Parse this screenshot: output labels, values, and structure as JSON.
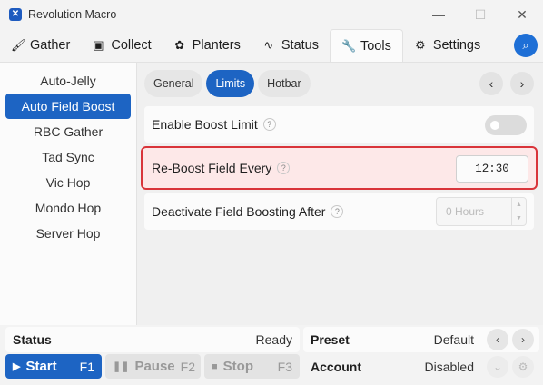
{
  "window": {
    "title": "Revolution Macro",
    "icon_glyph": "✕"
  },
  "tabs": [
    {
      "label": "Gather",
      "icon": "brush-icon"
    },
    {
      "label": "Collect",
      "icon": "chest-icon"
    },
    {
      "label": "Planters",
      "icon": "planter-icon"
    },
    {
      "label": "Status",
      "icon": "pulse-icon"
    },
    {
      "label": "Tools",
      "icon": "wrench-icon",
      "active": true
    },
    {
      "label": "Settings",
      "icon": "gear-icon"
    }
  ],
  "sidebar": {
    "items": [
      "Auto-Jelly",
      "Auto Field Boost",
      "RBC Gather",
      "Tad Sync",
      "Vic Hop",
      "Mondo Hop",
      "Server Hop"
    ],
    "active_index": 1
  },
  "subtabs": {
    "items": [
      "General",
      "Limits",
      "Hotbar"
    ],
    "active_index": 1
  },
  "settings": {
    "enable_boost_limit": {
      "label": "Enable Boost Limit",
      "enabled": false
    },
    "reboost_field_every": {
      "label": "Re-Boost Field Every",
      "value": "12:30"
    },
    "deactivate_after": {
      "label": "Deactivate Field Boosting After",
      "value": "0 Hours"
    },
    "help_glyph": "?"
  },
  "bottom": {
    "status_label": "Status",
    "status_value": "Ready",
    "start_label": "Start",
    "start_key": "F1",
    "pause_label": "Pause",
    "pause_key": "F2",
    "stop_label": "Stop",
    "stop_key": "F3",
    "preset_label": "Preset",
    "preset_value": "Default",
    "account_label": "Account",
    "account_value": "Disabled"
  },
  "colors": {
    "accent": "#1d64c3",
    "highlight_border": "#d9343a",
    "highlight_bg": "#fde8e8"
  }
}
